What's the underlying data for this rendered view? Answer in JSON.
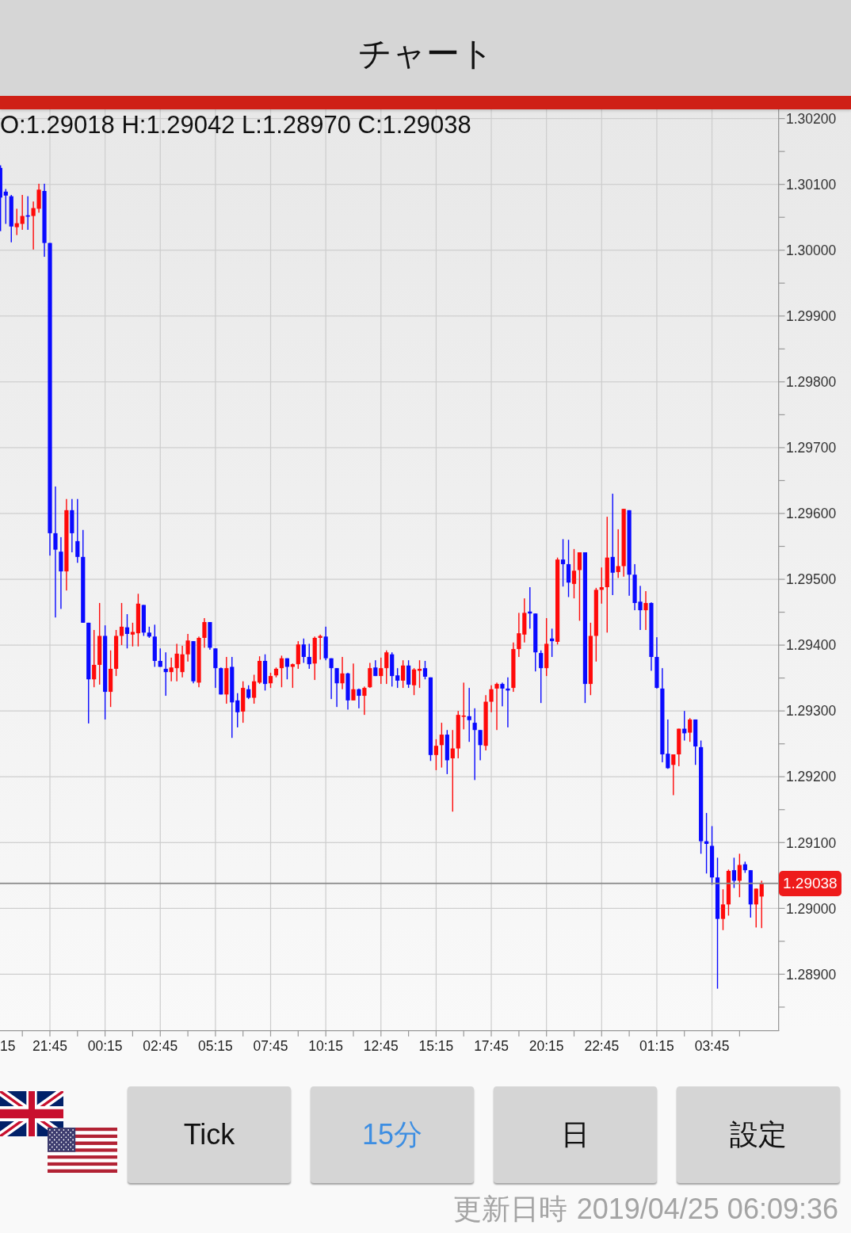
{
  "header": {
    "title": "チャート"
  },
  "chart": {
    "ohlc_readout": "O:1.29018 H:1.29042 L:1.28970 C:1.29038",
    "edge_time_label": "15",
    "chart_data": {
      "type": "candlestick",
      "categories": [
        null,
        null,
        null,
        null,
        null,
        null,
        null,
        null,
        null,
        null,
        "21:45",
        null,
        null,
        null,
        null,
        null,
        null,
        null,
        null,
        null,
        "00:15",
        null,
        null,
        null,
        null,
        null,
        null,
        null,
        null,
        null,
        "02:45",
        null,
        null,
        null,
        null,
        null,
        null,
        null,
        null,
        null,
        "05:15",
        null,
        null,
        null,
        null,
        null,
        null,
        null,
        null,
        null,
        "07:45",
        null,
        null,
        null,
        null,
        null,
        null,
        null,
        null,
        null,
        "10:15",
        null,
        null,
        null,
        null,
        null,
        null,
        null,
        null,
        null,
        "12:45",
        null,
        null,
        null,
        null,
        null,
        null,
        null,
        null,
        null,
        "15:15",
        null,
        null,
        null,
        null,
        null,
        null,
        null,
        null,
        null,
        "17:45",
        null,
        null,
        null,
        null,
        null,
        null,
        null,
        null,
        null,
        "20:15",
        null,
        null,
        null,
        null,
        null,
        null,
        null,
        null,
        null,
        "22:45",
        null,
        null,
        null,
        null,
        null,
        null,
        null,
        null,
        null,
        "01:15",
        null,
        null,
        null,
        null,
        null,
        null,
        null,
        null,
        null,
        "03:45",
        null,
        null,
        null,
        null,
        null,
        null,
        null,
        null,
        null
      ],
      "ohlc": [
        null,
        [
          1.30125,
          1.30129,
          1.30029,
          1.3008
        ],
        [
          1.30089,
          1.30093,
          1.3004,
          1.30083
        ],
        [
          1.30082,
          1.30084,
          1.30012,
          1.30036
        ],
        [
          1.30035,
          1.30063,
          1.30023,
          1.30041
        ],
        [
          1.3004,
          1.30084,
          1.30031,
          1.30052
        ],
        [
          1.30053,
          1.30082,
          1.30031,
          1.30051
        ],
        [
          1.30052,
          1.30074,
          1.30001,
          1.30064
        ],
        [
          1.30063,
          1.30101,
          1.30057,
          1.30092
        ],
        [
          1.3009,
          1.30101,
          1.2999,
          1.30011
        ],
        [
          1.30011,
          1.30011,
          1.29536,
          1.2957
        ],
        [
          1.2957,
          1.29641,
          1.29442,
          1.29545
        ],
        [
          1.29542,
          1.29564,
          1.29455,
          1.29512
        ],
        [
          1.29512,
          1.29622,
          1.29483,
          1.29605
        ],
        [
          1.29605,
          1.29622,
          1.29541,
          1.2957
        ],
        [
          1.29558,
          1.29622,
          1.29525,
          1.29534
        ],
        [
          1.29534,
          1.29575,
          1.29434,
          1.29434
        ],
        [
          1.29434,
          1.29434,
          1.29281,
          1.29348
        ],
        [
          1.29348,
          1.29423,
          1.29336,
          1.2937
        ],
        [
          1.2937,
          1.29464,
          1.2934,
          1.29414
        ],
        [
          1.29414,
          1.2943,
          1.29287,
          1.29329
        ],
        [
          1.29329,
          1.29392,
          1.29306,
          1.29364
        ],
        [
          1.29364,
          1.29423,
          1.29353,
          1.29414
        ],
        [
          1.29414,
          1.29464,
          1.294,
          1.29428
        ],
        [
          1.29427,
          1.29447,
          1.29395,
          1.29417
        ],
        [
          1.29416,
          1.29434,
          1.29398,
          1.2942
        ],
        [
          1.29418,
          1.29478,
          1.29398,
          1.29463
        ],
        [
          1.29461,
          1.29461,
          1.29414,
          1.29419
        ],
        [
          1.29419,
          1.29428,
          1.29411,
          1.29413
        ],
        [
          1.29413,
          1.29431,
          1.29367,
          1.29376
        ],
        [
          1.29376,
          1.29395,
          1.29367,
          1.29367
        ],
        [
          1.29364,
          1.29389,
          1.29323,
          1.29359
        ],
        [
          1.29359,
          1.29381,
          1.29345,
          1.29366
        ],
        [
          1.29365,
          1.29402,
          1.29345,
          1.29387
        ],
        [
          1.29359,
          1.29399,
          1.29351,
          1.29386
        ],
        [
          1.29386,
          1.29417,
          1.29375,
          1.29407
        ],
        [
          1.29406,
          1.29406,
          1.29342,
          1.29345
        ],
        [
          1.29343,
          1.29413,
          1.29336,
          1.29411
        ],
        [
          1.29411,
          1.29441,
          1.29396,
          1.29435
        ],
        [
          1.29435,
          1.29435,
          1.29393,
          1.29396
        ],
        [
          1.29395,
          1.29395,
          1.29335,
          1.29365
        ],
        [
          1.29365,
          1.29366,
          1.29325,
          1.29325
        ],
        [
          1.29325,
          1.29382,
          1.29311,
          1.29365
        ],
        [
          1.29367,
          1.29382,
          1.29259,
          1.29313
        ],
        [
          1.29316,
          1.29327,
          1.29275,
          1.29298
        ],
        [
          1.29299,
          1.29345,
          1.29282,
          1.29335
        ],
        [
          1.29333,
          1.29339,
          1.29318,
          1.2932
        ],
        [
          1.2932,
          1.29355,
          1.29311,
          1.29345
        ],
        [
          1.29343,
          1.29383,
          1.29341,
          1.29376
        ],
        [
          1.29376,
          1.29386,
          1.29331,
          1.29341
        ],
        [
          1.29342,
          1.29358,
          1.29335,
          1.29353
        ],
        [
          1.29354,
          1.29366,
          1.29351,
          1.29364
        ],
        [
          1.29365,
          1.29384,
          1.29336,
          1.2938
        ],
        [
          1.2938,
          1.2938,
          1.29348,
          1.29367
        ],
        [
          1.29367,
          1.29372,
          1.29335,
          1.29371
        ],
        [
          1.29371,
          1.29406,
          1.29364,
          1.29401
        ],
        [
          1.29401,
          1.2941,
          1.29373,
          1.29382
        ],
        [
          1.29382,
          1.29402,
          1.29364,
          1.29371
        ],
        [
          1.29372,
          1.29413,
          1.29347,
          1.29411
        ],
        [
          1.29411,
          1.29416,
          1.29378,
          1.29414
        ],
        [
          1.29413,
          1.29428,
          1.29377,
          1.2938
        ],
        [
          1.2938,
          1.2938,
          1.29318,
          1.29365
        ],
        [
          1.29365,
          1.29365,
          1.29306,
          1.29342
        ],
        [
          1.29342,
          1.29382,
          1.29333,
          1.29357
        ],
        [
          1.29357,
          1.29358,
          1.29302,
          1.29316
        ],
        [
          1.29316,
          1.29372,
          1.29316,
          1.29333
        ],
        [
          1.29333,
          1.29334,
          1.29304,
          1.29323
        ],
        [
          1.29323,
          1.29337,
          1.29294,
          1.29335
        ],
        [
          1.29336,
          1.29373,
          1.29335,
          1.29365
        ],
        [
          1.29366,
          1.29377,
          1.29353,
          1.29353
        ],
        [
          1.29353,
          1.29381,
          1.29341,
          1.29365
        ],
        [
          1.29365,
          1.29392,
          1.29341,
          1.29389
        ],
        [
          1.29386,
          1.29389,
          1.29337,
          1.29353
        ],
        [
          1.29354,
          1.29365,
          1.29335,
          1.29346
        ],
        [
          1.29346,
          1.29377,
          1.29335,
          1.29369
        ],
        [
          1.29369,
          1.29377,
          1.29335,
          1.2934
        ],
        [
          1.29339,
          1.29365,
          1.29324,
          1.29363
        ],
        [
          1.29361,
          1.29377,
          1.29335,
          1.29364
        ],
        [
          1.29365,
          1.29376,
          1.29348,
          1.29352
        ],
        [
          1.29351,
          1.29351,
          1.29224,
          1.29233
        ],
        [
          1.29233,
          1.29257,
          1.2921,
          1.29247
        ],
        [
          1.29248,
          1.29282,
          1.29214,
          1.29264
        ],
        [
          1.29264,
          1.29271,
          1.29204,
          1.29225
        ],
        [
          1.29228,
          1.29271,
          1.29147,
          1.29243
        ],
        [
          1.29243,
          1.293,
          1.29228,
          1.29294
        ],
        [
          1.29292,
          1.29343,
          1.29272,
          1.29293
        ],
        [
          1.29292,
          1.29335,
          1.29253,
          1.29286
        ],
        [
          1.29282,
          1.29304,
          1.29195,
          1.29271
        ],
        [
          1.29271,
          1.29271,
          1.29225,
          1.29248
        ],
        [
          1.29247,
          1.29324,
          1.2924,
          1.29314
        ],
        [
          1.29314,
          1.29339,
          1.29298,
          1.29333
        ],
        [
          1.29334,
          1.29343,
          1.29271,
          1.29341
        ],
        [
          1.29341,
          1.29343,
          1.29307,
          1.29334
        ],
        [
          1.29334,
          1.29351,
          1.29275,
          1.29331
        ],
        [
          1.29335,
          1.29404,
          1.29329,
          1.29394
        ],
        [
          1.29394,
          1.29449,
          1.29382,
          1.29418
        ],
        [
          1.29416,
          1.29471,
          1.29404,
          1.29449
        ],
        [
          1.29451,
          1.29488,
          1.29425,
          1.29448
        ],
        [
          1.29448,
          1.29448,
          1.2936,
          1.29389
        ],
        [
          1.29388,
          1.29392,
          1.29312,
          1.29365
        ],
        [
          1.29365,
          1.29441,
          1.29353,
          1.29402
        ],
        [
          1.2941,
          1.29425,
          1.29382,
          1.29406
        ],
        [
          1.29405,
          1.29533,
          1.29401,
          1.2953
        ],
        [
          1.2953,
          1.29561,
          1.29489,
          1.29523
        ],
        [
          1.29523,
          1.2956,
          1.29473,
          1.29495
        ],
        [
          1.29493,
          1.29546,
          1.29471,
          1.29513
        ],
        [
          1.29514,
          1.29541,
          1.29437,
          1.29541
        ],
        [
          1.29541,
          1.29541,
          1.29312,
          1.29341
        ],
        [
          1.29341,
          1.29434,
          1.29324,
          1.29414
        ],
        [
          1.29414,
          1.29487,
          1.29375,
          1.29484
        ],
        [
          1.29484,
          1.29518,
          1.29463,
          1.29488
        ],
        [
          1.29488,
          1.29595,
          1.29419,
          1.29533
        ],
        [
          1.29534,
          1.2963,
          1.29476,
          1.2951
        ],
        [
          1.29511,
          1.29576,
          1.29502,
          1.2952
        ],
        [
          1.2952,
          1.29607,
          1.29504,
          1.29607
        ],
        [
          1.29605,
          1.29605,
          1.29475,
          1.29507
        ],
        [
          1.29507,
          1.29523,
          1.29453,
          1.29464
        ],
        [
          1.29466,
          1.2949,
          1.29423,
          1.29453
        ],
        [
          1.29453,
          1.29482,
          1.29423,
          1.29464
        ],
        [
          1.29464,
          1.29465,
          1.29361,
          1.29382
        ],
        [
          1.29382,
          1.29412,
          1.29334,
          1.29335
        ],
        [
          1.29334,
          1.29365,
          1.29222,
          1.29234
        ],
        [
          1.29235,
          1.29287,
          1.29212,
          1.29213
        ],
        [
          1.29218,
          1.29234,
          1.29172,
          1.29234
        ],
        [
          1.29234,
          1.29273,
          1.29216,
          1.29273
        ],
        [
          1.29273,
          1.293,
          1.29255,
          1.29266
        ],
        [
          1.29267,
          1.29289,
          1.29253,
          1.29287
        ],
        [
          1.29287,
          1.29287,
          1.29218,
          1.29246
        ],
        [
          1.29245,
          1.29255,
          1.29083,
          1.29102
        ],
        [
          1.29102,
          1.29145,
          1.29053,
          1.29098
        ],
        [
          1.29095,
          1.29125,
          1.29036,
          1.29047
        ],
        [
          1.29047,
          1.29077,
          1.28878,
          1.28984
        ],
        [
          1.28984,
          1.29029,
          1.28967,
          1.29006
        ],
        [
          1.29006,
          1.29059,
          1.28989,
          1.29057
        ],
        [
          1.29058,
          1.29077,
          1.29031,
          1.29042
        ],
        [
          1.29042,
          1.29083,
          1.29017,
          1.29066
        ],
        [
          1.29067,
          1.29071,
          1.29054,
          1.29058
        ],
        [
          1.29058,
          1.29058,
          1.28986,
          1.29006
        ],
        [
          1.29006,
          1.2903,
          1.28971,
          1.2903
        ],
        [
          1.29018,
          1.29042,
          1.2897,
          1.29038
        ]
      ],
      "ylim": [
        1.28815,
        1.30214
      ],
      "yticks": [
        {
          "value": 1.302,
          "label": "1.30200"
        },
        {
          "value": 1.301,
          "label": "1.30100"
        },
        {
          "value": 1.3,
          "label": "1.30000"
        },
        {
          "value": 1.299,
          "label": "1.29900"
        },
        {
          "value": 1.298,
          "label": "1.29800"
        },
        {
          "value": 1.297,
          "label": "1.29700"
        },
        {
          "value": 1.296,
          "label": "1.29600"
        },
        {
          "value": 1.295,
          "label": "1.29500"
        },
        {
          "value": 1.294,
          "label": "1.29400"
        },
        {
          "value": 1.293,
          "label": "1.29300"
        },
        {
          "value": 1.292,
          "label": "1.29200"
        },
        {
          "value": 1.291,
          "label": "1.29100"
        },
        {
          "value": 1.29,
          "label": "1.29000"
        },
        {
          "value": 1.289,
          "label": "1.28900"
        }
      ],
      "ref_lines": [
        {
          "axis": "y",
          "value": 1.29038,
          "label": "1.29038"
        }
      ]
    }
  },
  "buttons": [
    {
      "label": "Tick",
      "selected": false
    },
    {
      "label": "15分",
      "selected": true
    },
    {
      "label": "日",
      "selected": false
    },
    {
      "label": "設定",
      "selected": false
    }
  ],
  "updated": {
    "label": "更新日時",
    "value": "2019/04/25 06:09:36"
  }
}
